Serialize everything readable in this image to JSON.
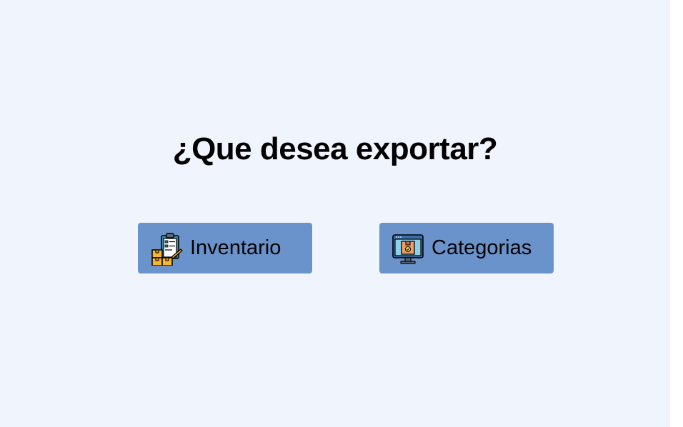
{
  "main": {
    "title": "¿Que desea exportar?"
  },
  "buttons": {
    "inventario": {
      "label": "Inventario",
      "icon": "inventory-clipboard-boxes-icon"
    },
    "categorias": {
      "label": "Categorias",
      "icon": "monitor-package-icon"
    }
  },
  "colors": {
    "background": "#f0f4fc",
    "button": "#6a93cb",
    "text": "#000000"
  }
}
